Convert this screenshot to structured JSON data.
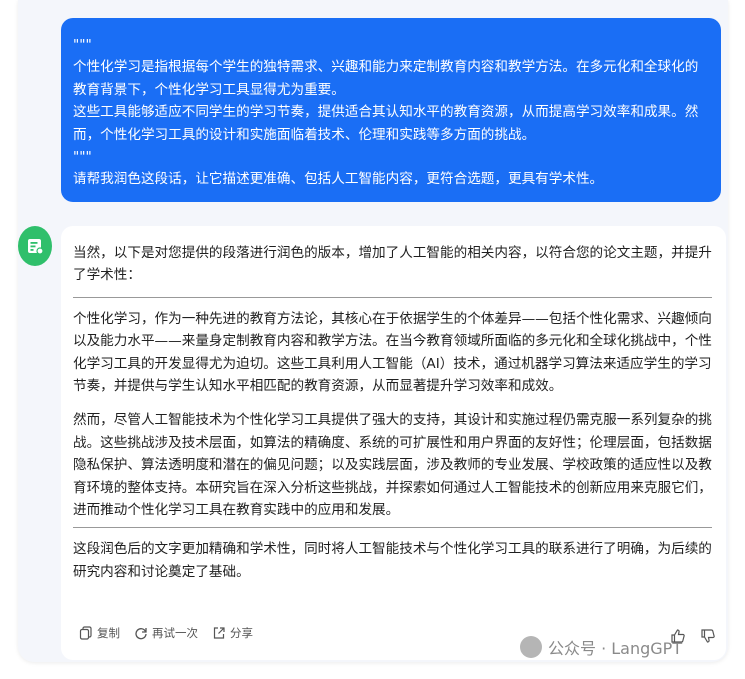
{
  "user_message": {
    "lines": [
      "\"\"\"",
      "个性化学习是指根据每个学生的独特需求、兴趣和能力来定制教育内容和教学方法。在多元化和全球化的教育背景下，个性化学习工具显得尤为重要。",
      "这些工具能够适应不同学生的学习节奏，提供适合其认知水平的教育资源，从而提高学习效率和成果。然而，个性化学习工具的设计和实施面临着技术、伦理和实践等多方面的挑战。",
      "\"\"\"",
      "请帮我润色这段话，让它描述更准确、包括人工智能内容，更符合选题，更具有学术性。"
    ]
  },
  "assistant_message": {
    "intro": "当然，以下是对您提供的段落进行润色的版本，增加了人工智能的相关内容，以符合您的论文主题，并提升了学术性：",
    "paragraph_1": "个性化学习，作为一种先进的教育方法论，其核心在于依据学生的个体差异——包括个性化需求、兴趣倾向以及能力水平——来量身定制教育内容和教学方法。在当今教育领域所面临的多元化和全球化挑战中，个性化学习工具的开发显得尤为迫切。这些工具利用人工智能（AI）技术，通过机器学习算法来适应学生的学习节奏，并提供与学生认知水平相匹配的教育资源，从而显著提升学习效率和成效。",
    "paragraph_2": "然而，尽管人工智能技术为个性化学习工具提供了强大的支持，其设计和实施过程仍需克服一系列复杂的挑战。这些挑战涉及技术层面，如算法的精确度、系统的可扩展性和用户界面的友好性；伦理层面，包括数据隐私保护、算法透明度和潜在的偏见问题；以及实践层面，涉及教师的专业发展、学校政策的适应性以及教育环境的整体支持。本研究旨在深入分析这些挑战，并探索如何通过人工智能技术的创新应用来克服它们，进而推动个性化学习工具在教育实践中的应用和发展。",
    "conclusion": "这段润色后的文字更加精确和学术性，同时将人工智能技术与个性化学习工具的联系进行了明确，为后续的研究内容和讨论奠定了基础。"
  },
  "actions": {
    "copy_label": "复制",
    "retry_label": "再试一次",
    "share_label": "分享"
  },
  "icons": {
    "avatar": "robot-document-icon",
    "copy": "copy-icon",
    "retry": "refresh-icon",
    "share": "share-icon",
    "like": "thumbs-up-icon",
    "dislike": "thumbs-down-icon"
  },
  "watermark": {
    "text": "公众号 · LangGPT"
  },
  "colors": {
    "user_bubble": "#1a6ef5",
    "avatar": "#2fbf6b",
    "background": "#f4f6fb"
  }
}
